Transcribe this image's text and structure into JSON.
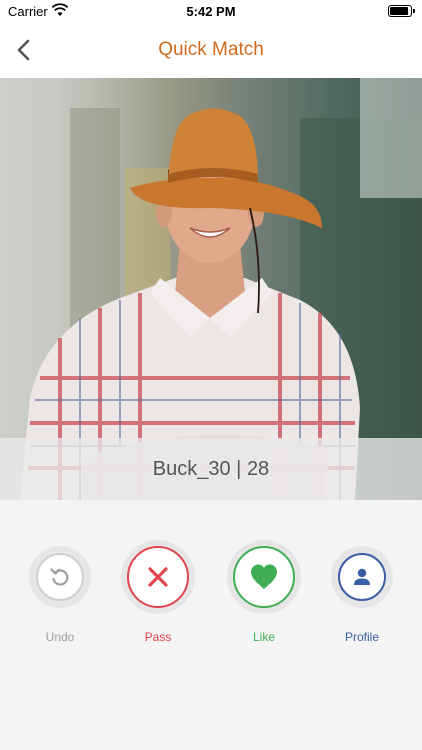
{
  "status_bar": {
    "carrier": "Carrier",
    "time": "5:42 PM"
  },
  "nav": {
    "title": "Quick Match",
    "back_icon": "chevron-left-icon"
  },
  "profile": {
    "name_age": "Buck_30 | 28"
  },
  "actions": [
    {
      "label": "Undo",
      "icon": "undo-icon",
      "color": "#9e9e9e"
    },
    {
      "label": "Pass",
      "icon": "close-icon",
      "color": "#e0464a"
    },
    {
      "label": "Like",
      "icon": "heart-icon",
      "color": "#3fae55"
    },
    {
      "label": "Profile",
      "icon": "person-icon",
      "color": "#3b5ea6"
    }
  ],
  "colors": {
    "accent": "#d2691e"
  }
}
